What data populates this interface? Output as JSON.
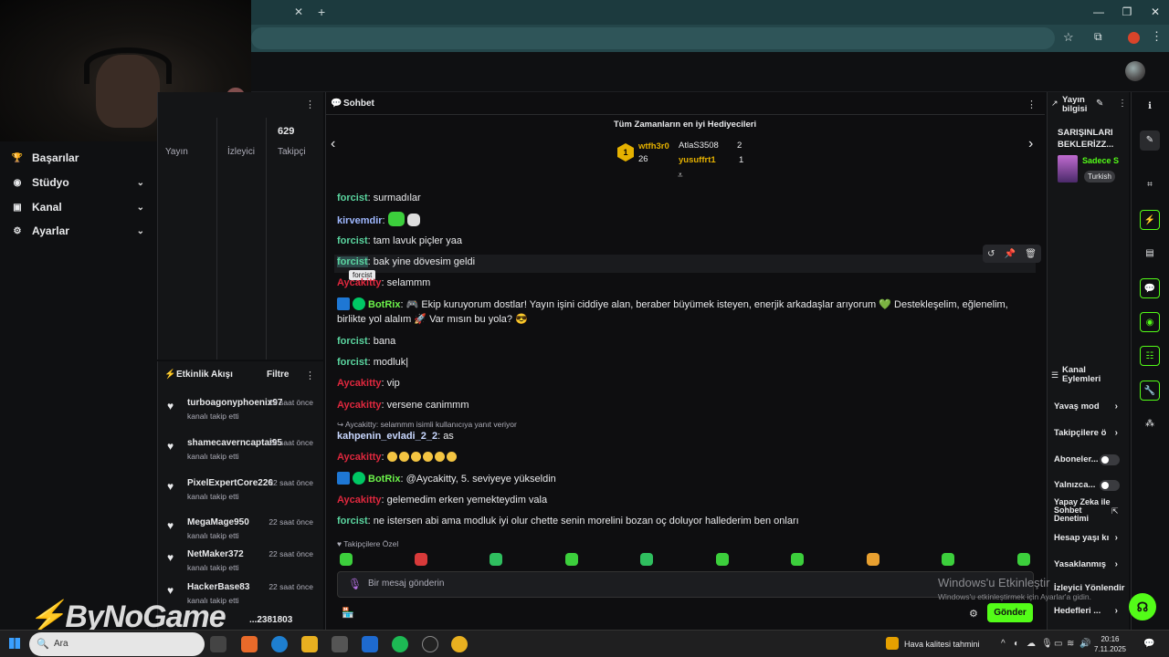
{
  "browser": {
    "tab_close": "✕",
    "tab_new": "+",
    "minimize": "—",
    "maximize": "❐",
    "close": "✕"
  },
  "nav": [
    {
      "label": "Başarılar",
      "icon": "trophy-icon",
      "glyph": "🏆",
      "chevron": false
    },
    {
      "label": "Stüdyo",
      "icon": "studio-icon",
      "glyph": "◉",
      "chevron": true
    },
    {
      "label": "Kanal",
      "icon": "channel-icon",
      "glyph": "▣",
      "chevron": true
    },
    {
      "label": "Ayarlar",
      "icon": "gear-icon",
      "glyph": "⚙",
      "chevron": true
    }
  ],
  "stats": {
    "followers_count": "629",
    "labels": [
      "Yayın",
      "İzleyici",
      "Takipçi"
    ]
  },
  "feed": {
    "title": "Etkinlik Akışı",
    "filter": "Filtre",
    "items": [
      {
        "name": "turboagonyphoenix97",
        "action": "kanalı takip etti",
        "time": "22 saat önce"
      },
      {
        "name": "shamecaverncaptai95",
        "action": "kanalı takip etti",
        "time": "22 saat önce"
      },
      {
        "name": "PixelExpertCore226",
        "action": "kanalı takip etti",
        "time": "22 saat önce"
      },
      {
        "name": "MegaMage950",
        "action": "kanalı takip etti",
        "time": "22 saat önce"
      },
      {
        "name": "NetMaker372",
        "action": "kanalı takip etti",
        "time": "22 saat önce"
      },
      {
        "name": "HackerBase83",
        "action": "kanalı takip etti",
        "time": "22 saat önce"
      },
      {
        "name": "...2381803",
        "action": "",
        "time": "22 saat önce"
      }
    ]
  },
  "chat": {
    "title": "Sohbet",
    "gifters_title": "Tüm Zamanların en iyi Hediyecileri",
    "gifters": [
      {
        "rank": "1",
        "name": "wtfh3r0",
        "value": "26"
      },
      {
        "name": "AtlaS3508",
        "value": "2"
      },
      {
        "name": "yusuffrt1",
        "value": "1"
      }
    ],
    "messages": [
      {
        "user": "forcist",
        "text": "surmadılar"
      },
      {
        "user": "kirvemdir",
        "text": ""
      },
      {
        "user": "forcist",
        "text": "tam lavuk piçler yaa"
      },
      {
        "user": "forcist",
        "text": "bak yine dövesim geldi"
      },
      {
        "user": "Aycakitty",
        "text": "selammm"
      },
      {
        "user": "BotRix",
        "text": "🎮 Ekip kuruyorum dostlar! Yayın işini ciddiye alan, beraber büyümek isteyen, enerjik arkadaşlar arıyorum 💚 Destekleşelim, eğlenelim,",
        "text2": "birlikte yol alalım 🚀 Var mısın bu yola? 😎"
      },
      {
        "user": "forcist",
        "text": "bana"
      },
      {
        "user": "forcist",
        "text": "modluk|"
      },
      {
        "user": "Aycakitty",
        "text": "vip"
      },
      {
        "user": "Aycakitty",
        "text": "versene canimmm"
      },
      {
        "user": "kahpenin_evladi_2_2",
        "text": "as"
      },
      {
        "user": "Aycakitty",
        "text": ""
      },
      {
        "user": "BotRix",
        "text": "@Aycakitty, 5. seviyeye yükseldin"
      },
      {
        "user": "Aycakitty",
        "text": "gelemedim erken yemekteydim vala"
      },
      {
        "user": "forcist",
        "text": "ne istersen abi ama modluk iyi olur chette senin morelini bozan oç doluyor hallederim ben onları"
      }
    ],
    "reply_hint": "↪ Aycakitty: selammm isimli kullanıcıya yanıt veriyor",
    "tooltip": "forcist",
    "followers_only": "♥ Takipçilere Özel",
    "input_placeholder": "Bir mesaj gönderin",
    "send": "Gönder"
  },
  "stream_info": {
    "title": "Yayın bilgisi",
    "stream_title": "SARIŞINLARI BEKLERİZZ...",
    "category": "Sadece S",
    "language": "Turkish"
  },
  "channel_actions": {
    "title": "Kanal Eylemleri",
    "items": [
      {
        "label": "Yavaş mod",
        "control": "arrow"
      },
      {
        "label": "Takipçilere ö",
        "control": "arrow"
      },
      {
        "label": "Aboneler...",
        "control": "toggle"
      },
      {
        "label": "Yalnızca...",
        "control": "toggle"
      },
      {
        "label": "Yapay Zeka ile Sohbet Denetimi",
        "control": "external"
      },
      {
        "label": "Hesap yaşı kı",
        "control": "arrow"
      },
      {
        "label": "Yasaklanmış",
        "control": "arrow"
      },
      {
        "label": "İzleyici Yönlendir",
        "control": "none"
      },
      {
        "label": "Hedefleri ...",
        "control": "arrow"
      }
    ]
  },
  "watermark": {
    "line1": "Windows'u Etkinleştir",
    "line2": "Windows'u etkinleştirmek için Ayarlar'a gidin."
  },
  "logo": "ByNoGame",
  "taskbar": {
    "search_placeholder": "Ara",
    "weather": "Hava kalitesi tahmini",
    "time": "20:16",
    "date": "7.11.2025"
  }
}
